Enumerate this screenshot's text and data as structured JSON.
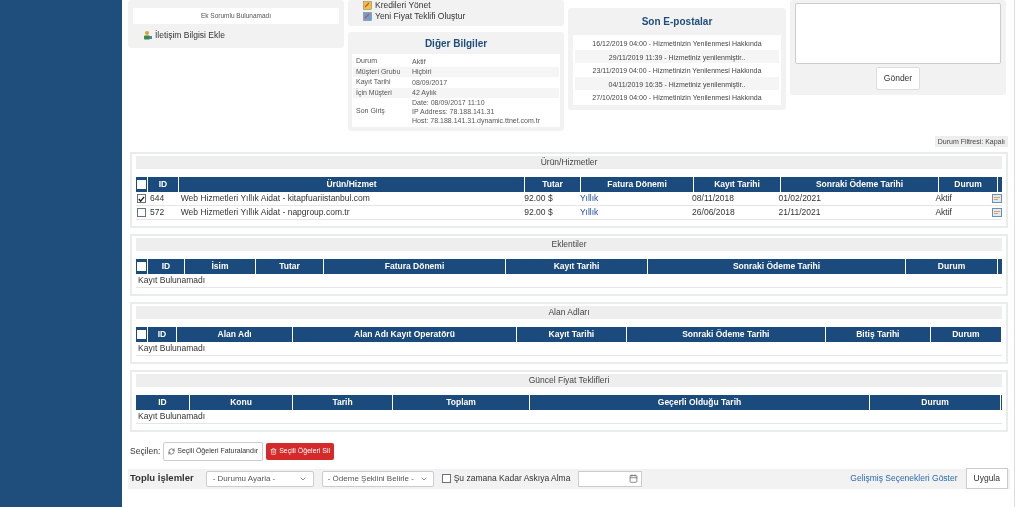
{
  "contacts_panel": {
    "empty_message": "Ek Sorumlu Bulunamadı",
    "add_link": "İletişim Bilgisi Ekle"
  },
  "actions_panel": {
    "links": [
      "Kredileri Yönet",
      "Yeni Fiyat Teklifi Oluştur"
    ]
  },
  "other_info": {
    "title": "Diğer Bilgiler",
    "rows": [
      {
        "label": "Durum",
        "value": [
          "Aktif"
        ]
      },
      {
        "label": "Müşteri Grubu",
        "value": [
          "Hiçbiri"
        ]
      },
      {
        "label": "Kayıt Tarihi",
        "value": [
          "08/09/2017"
        ]
      },
      {
        "label": "İçin Müşteri",
        "value": [
          "42 Aylık"
        ]
      },
      {
        "label": "Son Giriş",
        "value": [
          "Date: 08/09/2017 11:10",
          "IP Address: 78.188.141.31",
          "Host: 78.188.141.31.dynamic.ttnet.com.tr"
        ]
      }
    ]
  },
  "recent_emails": {
    "title": "Son E-postalar",
    "items": [
      "16/12/2019 04:00 - Hizmetinizin Yenilenmesi Hakkında",
      "29/11/2019 11:39 - Hizmetiniz yenilenmiştir..",
      "23/11/2019 04:00 - Hizmetinizin Yenilenmesi Hakkında",
      "04/11/2019 16:35 - Hizmetiniz yenilenmiştir..",
      "27/10/2019 04:00 - Hizmetinizin Yenilenmesi Hakkında"
    ]
  },
  "notes": {
    "send_button": "Gönder"
  },
  "status_filter": "Durum Filtresi: Kapalı",
  "sections": [
    {
      "title": "Ürün/Hizmetler",
      "has_checkbox": true,
      "header_checked": false,
      "columns": [
        "ID",
        "Ürün/Hizmet",
        "Tutar",
        "Fatura Dönemi",
        "Kayıt Tarihi",
        "Sonraki Ödeme Tarihi",
        "Durum"
      ],
      "rows": [
        {
          "selected": true,
          "cells": [
            "644",
            "Web Hizmetleri Yıllık Aidat - kitapfuariistanbul.com",
            "92.00 $",
            "Yıllık",
            "08/11/2018",
            "01/02/2021",
            "Aktif"
          ]
        },
        {
          "selected": false,
          "cells": [
            "572",
            "Web Hizmetleri Yıllık Aidat - napgroup.com.tr",
            "92.00 $",
            "Yıllık",
            "26/06/2018",
            "21/11/2021",
            "Aktif"
          ]
        }
      ]
    },
    {
      "title": "Eklentiler",
      "has_checkbox": true,
      "header_checked": false,
      "columns": [
        "ID",
        "İsim",
        "Tutar",
        "Fatura Dönemi",
        "Kayıt Tarihi",
        "Sonraki Ödeme Tarihi",
        "Durum"
      ],
      "empty_message": "Kayıt Bulunamadı"
    },
    {
      "title": "Alan Adları",
      "has_checkbox": true,
      "header_checked": false,
      "columns": [
        "ID",
        "Alan Adı",
        "Alan Adı Kayıt Operatörü",
        "Kayıt Tarihi",
        "Sonraki Ödeme Tarihi",
        "Bitiş Tarihi",
        "Durum"
      ],
      "empty_message": "Kayıt Bulunamadı"
    },
    {
      "title": "Güncel Fiyat Teklifleri",
      "has_checkbox": false,
      "columns": [
        "ID",
        "Konu",
        "Tarih",
        "Toplam",
        "Geçerli Olduğu Tarih",
        "Durum"
      ],
      "empty_message": "Kayıt Bulunamadı"
    }
  ],
  "selected_actions": {
    "label": "Seçilen:",
    "invoice_button": "Seçili Öğeleri Faturalandır",
    "delete_button": "Seçili Öğeleri Sil"
  },
  "bulk_actions": {
    "label": "Toplu İşlemler",
    "status_select": "- Durumu Ayarla -",
    "payment_select": "- Ödeme Şeklini Belirle -",
    "suspend_checkbox": {
      "label": "Şu zamana Kadar Askıya Alma",
      "checked": false
    },
    "advanced_link": "Gelişmiş Seçenekleri Göster",
    "apply_button": "Uygula"
  }
}
